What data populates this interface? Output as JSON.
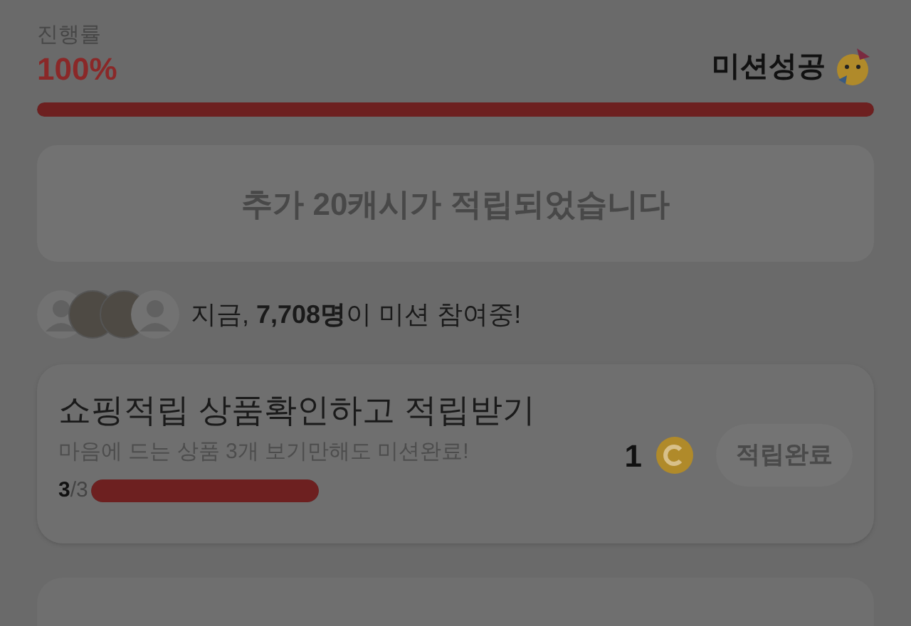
{
  "progress": {
    "label": "진행률",
    "value": "100%",
    "status": "미션성공",
    "level": 1
  },
  "banner": {
    "text": "추가 20캐시가 적립되었습니다",
    "disabled": true
  },
  "participants": {
    "avatars": [
      {
        "kind": "silhouette"
      },
      {
        "kind": "photo"
      },
      {
        "kind": "photo"
      },
      {
        "kind": "silhouette"
      }
    ],
    "text": "지금, **7,708명**이 미션 참여중!"
  },
  "missions": [
    {
      "title": "쇼핑적립 상품확인하고 적립받기",
      "description": "마음에 드는 상품 3개 보기만해도 미션완료!",
      "done": "3",
      "total": "/3",
      "level": 1,
      "reward": "1",
      "button": "적립완료",
      "completed": true
    }
  ]
}
